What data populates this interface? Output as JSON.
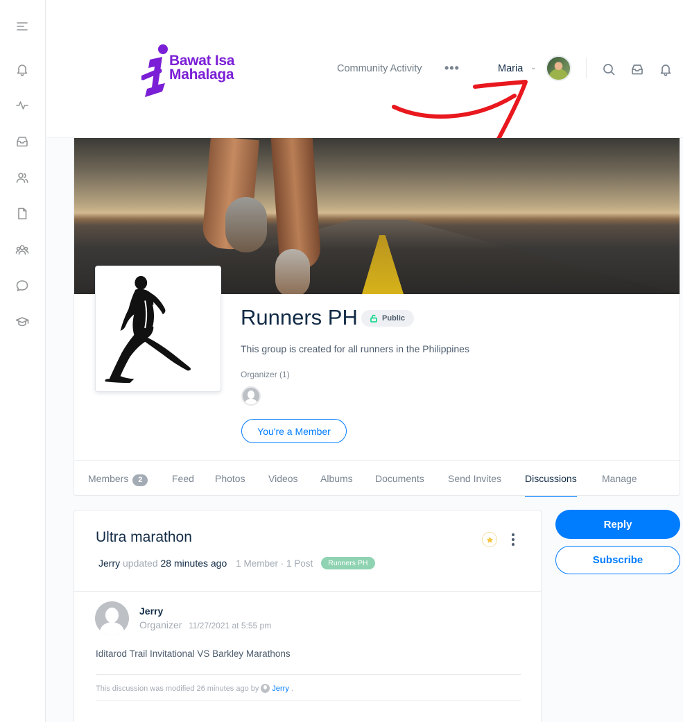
{
  "sidebar": {
    "items": [
      {
        "name": "menu-toggle",
        "icon": "menu-icon"
      },
      {
        "name": "notifications",
        "icon": "bell-icon"
      },
      {
        "name": "activity",
        "icon": "activity-icon"
      },
      {
        "name": "inbox",
        "icon": "inbox-icon"
      },
      {
        "name": "members",
        "icon": "users-icon"
      },
      {
        "name": "pages",
        "icon": "file-icon"
      },
      {
        "name": "groups",
        "icon": "groups-icon"
      },
      {
        "name": "forums",
        "icon": "chat-icon"
      },
      {
        "name": "courses",
        "icon": "graduation-cap-icon"
      }
    ]
  },
  "header": {
    "logo_line1": "Bawat Isa",
    "logo_line2": "Mahalaga",
    "logo_color": "#7b1fd6",
    "nav_link": "Community Activity",
    "more": "•••",
    "user_name": "Maria",
    "user_chevron": "⌄",
    "icons": [
      "search-icon",
      "inbox-icon",
      "bell-icon"
    ],
    "annotation_arrow_color": "#e8181e"
  },
  "group": {
    "name": "Runners PH",
    "privacy": "Public",
    "description": "This group is created for all runners in the Philippines",
    "organizer_label": "Organizer (1)",
    "membership_button": "You're a Member",
    "tabs": [
      {
        "label": "Members",
        "count": "2"
      },
      {
        "label": "Feed"
      },
      {
        "label": "Photos"
      },
      {
        "label": "Videos"
      },
      {
        "label": "Albums"
      },
      {
        "label": "Documents"
      },
      {
        "label": "Send Invites"
      },
      {
        "label": "Discussions",
        "active": true
      },
      {
        "label": "Manage"
      }
    ]
  },
  "discussion": {
    "title": "Ultra marathon",
    "author": "Jerry",
    "updated_text": "updated",
    "updated_ago": "28 minutes ago",
    "stats": "1 Member · 1 Post",
    "group_tag": "Runners PH",
    "post": {
      "author": "Jerry",
      "role": "Organizer",
      "timestamp": "11/27/2021 at 5:55 pm",
      "body": "Iditarod Trail Invitational VS Barkley Marathons",
      "modified_prefix": "This discussion was modified 26 minutes ago by",
      "modified_by": "Jerry",
      "modified_suffix": "."
    }
  },
  "actions": {
    "reply": "Reply",
    "subscribe": "Subscribe"
  },
  "colors": {
    "primary": "#007cff",
    "heading": "#122b46",
    "muted": "#a3abb4",
    "group_tag_bg": "#8fd3b2"
  }
}
